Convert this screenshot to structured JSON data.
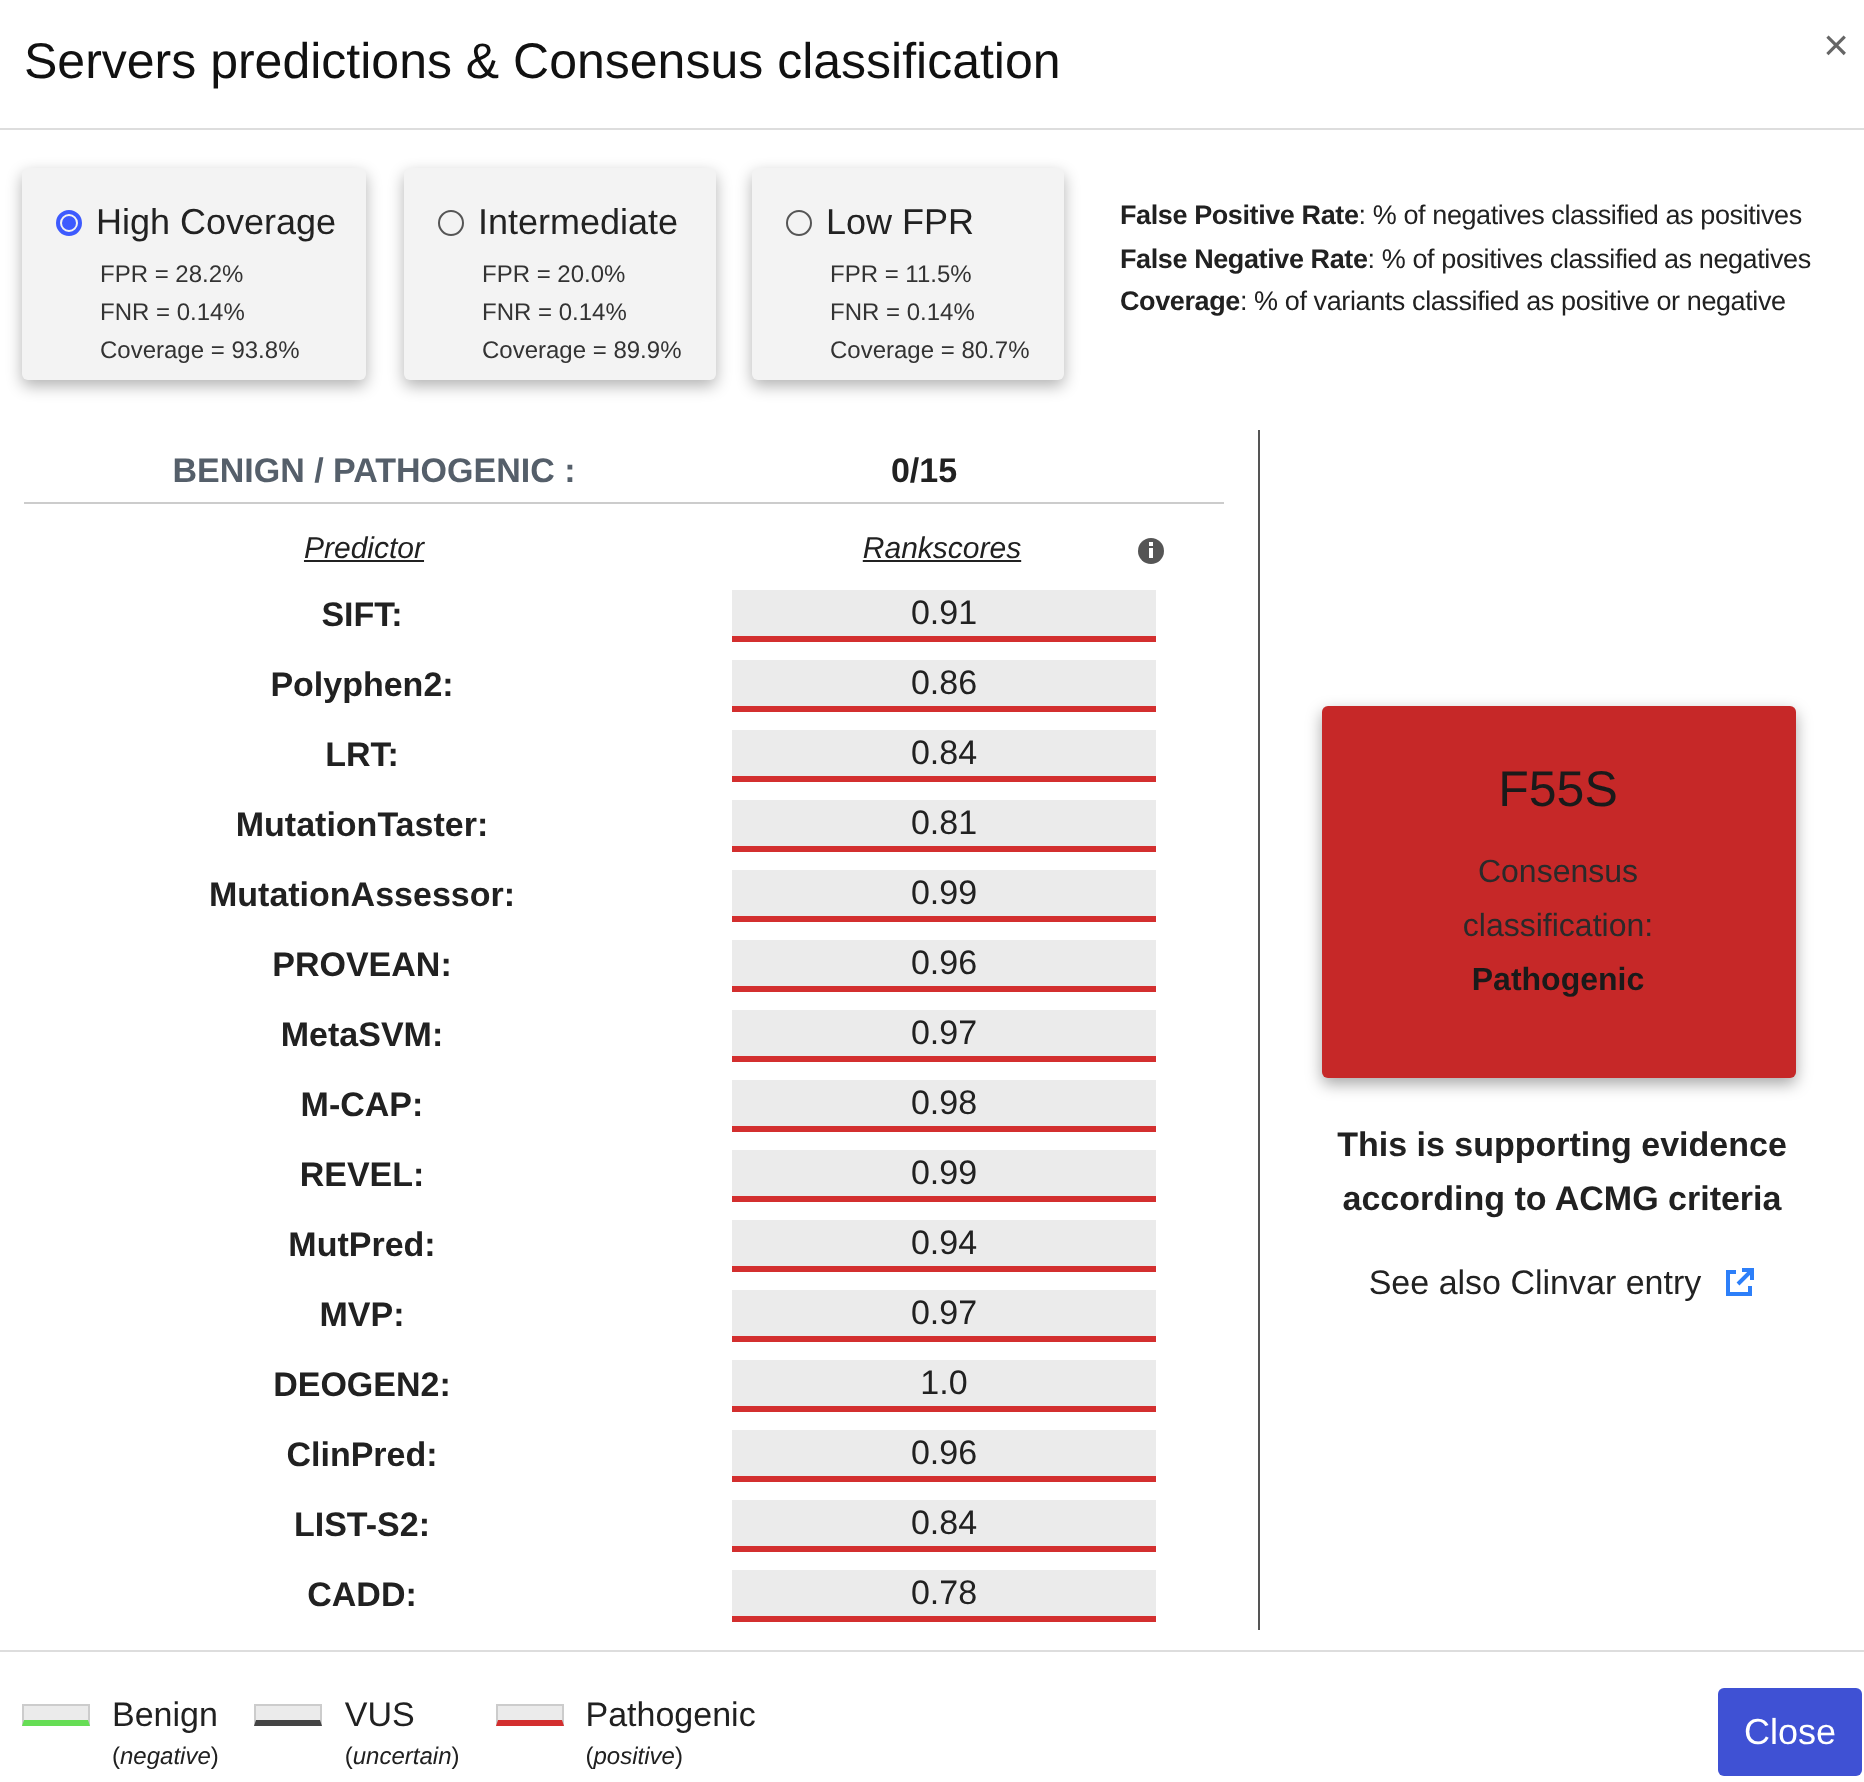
{
  "dialog": {
    "title": "Servers predictions & Consensus classification",
    "close_icon": "×"
  },
  "thresholds": [
    {
      "label": "High Coverage",
      "selected": true,
      "fpr": "FPR = 28.2%",
      "fnr": "FNR = 0.14%",
      "coverage": "Coverage = 93.8%"
    },
    {
      "label": "Intermediate",
      "selected": false,
      "fpr": "FPR = 20.0%",
      "fnr": "FNR = 0.14%",
      "coverage": "Coverage = 89.9%"
    },
    {
      "label": "Low FPR",
      "selected": false,
      "fpr": "FPR = 11.5%",
      "fnr": "FNR = 0.14%",
      "coverage": "Coverage = 80.7%"
    }
  ],
  "definitions": [
    "**False Positive Rate**: % of negatives classified as positives",
    "**False Negative Rate**: % of positives classified as negatives",
    "**Coverage**: % of variants classified as positive or negative"
  ],
  "summary": {
    "label": "BENIGN / PATHOGENIC :",
    "value": "0/15"
  },
  "table": {
    "columns": [
      "Predictor",
      "Rankscores"
    ],
    "rows": [
      {
        "predictor": "SIFT:",
        "score": "0.91",
        "kind": "pathogenic"
      },
      {
        "predictor": "Polyphen2:",
        "score": "0.86",
        "kind": "pathogenic"
      },
      {
        "predictor": "LRT:",
        "score": "0.84",
        "kind": "pathogenic"
      },
      {
        "predictor": "MutationTaster:",
        "score": "0.81",
        "kind": "pathogenic"
      },
      {
        "predictor": "MutationAssessor:",
        "score": "0.99",
        "kind": "pathogenic"
      },
      {
        "predictor": "PROVEAN:",
        "score": "0.96",
        "kind": "pathogenic"
      },
      {
        "predictor": "MetaSVM:",
        "score": "0.97",
        "kind": "pathogenic"
      },
      {
        "predictor": "M-CAP:",
        "score": "0.98",
        "kind": "pathogenic"
      },
      {
        "predictor": "REVEL:",
        "score": "0.99",
        "kind": "pathogenic"
      },
      {
        "predictor": "MutPred:",
        "score": "0.94",
        "kind": "pathogenic"
      },
      {
        "predictor": "MVP:",
        "score": "0.97",
        "kind": "pathogenic"
      },
      {
        "predictor": "DEOGEN2:",
        "score": "1.0",
        "kind": "pathogenic"
      },
      {
        "predictor": "ClinPred:",
        "score": "0.96",
        "kind": "pathogenic"
      },
      {
        "predictor": "LIST-S2:",
        "score": "0.84",
        "kind": "pathogenic"
      },
      {
        "predictor": "CADD:",
        "score": "0.78",
        "kind": "pathogenic"
      }
    ]
  },
  "consensus": {
    "variant": "F55S",
    "label": "Consensus classification:",
    "classification": "Pathogenic",
    "kind": "pathogenic",
    "evidence": "This is supporting evidence according to ACMG criteria",
    "link": "See also Clinvar entry"
  },
  "legend": [
    {
      "kind": "benign",
      "label": "Benign",
      "note": "(*negative*)"
    },
    {
      "kind": "vus",
      "label": "VUS",
      "note": "(*uncertain*)"
    },
    {
      "kind": "pathogenic",
      "label": "Pathogenic",
      "note": "(*positive*)"
    }
  ],
  "buttons": [
    "Close"
  ]
}
